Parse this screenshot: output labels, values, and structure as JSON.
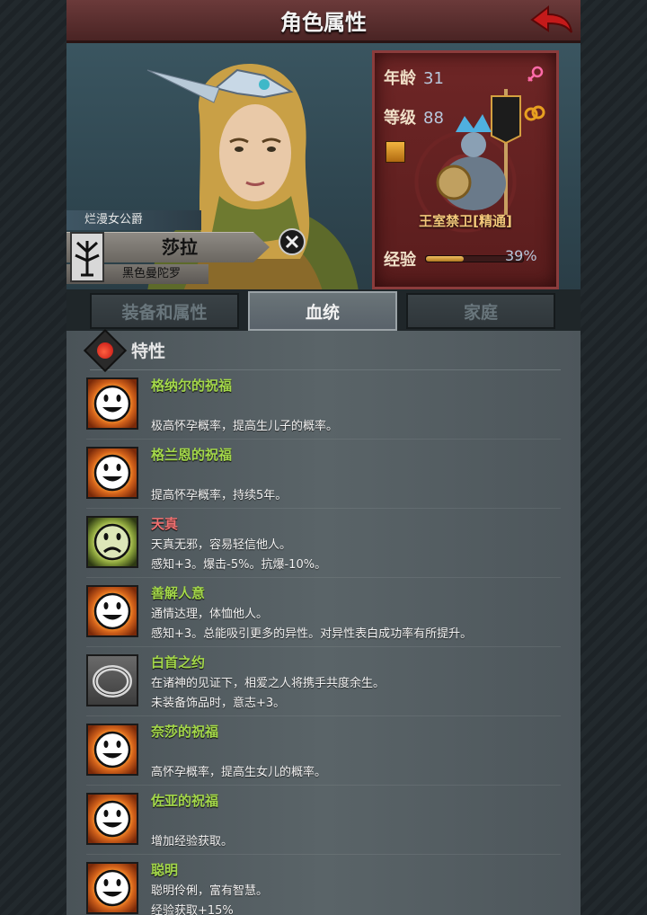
{
  "header": {
    "title": "角色属性"
  },
  "character": {
    "title_tag": "烂漫女公爵",
    "name": "莎拉",
    "house": "黑色曼陀罗",
    "age_label": "年龄",
    "age": "31",
    "level_label": "等级",
    "level": "88",
    "unit": "王室禁卫[精通]",
    "exp_label": "经验",
    "exp_percent": "39%",
    "exp_fraction": 0.39
  },
  "tabs": [
    {
      "label": "装备和属性"
    },
    {
      "label": "血统"
    },
    {
      "label": "家庭"
    }
  ],
  "active_tab": 1,
  "section": {
    "title": "特性"
  },
  "traits": [
    {
      "name": "格纳尔的祝福",
      "icon": "smile-icon",
      "kind": "good",
      "lines": [
        "极高怀孕概率，提高生儿子的概率。"
      ]
    },
    {
      "name": "格兰恩的祝福",
      "icon": "smile-icon",
      "kind": "good",
      "lines": [
        "提高怀孕概率，持续5年。"
      ]
    },
    {
      "name": "天真",
      "icon": "frown-icon",
      "kind": "bad",
      "lines": [
        "天真无邪，容易轻信他人。",
        "感知+3。爆击-5%。抗爆-10%。"
      ]
    },
    {
      "name": "善解人意",
      "icon": "smile-icon",
      "kind": "good",
      "lines": [
        "通情达理，体恤他人。",
        "感知+3。总能吸引更多的异性。对异性表白成功率有所提升。"
      ]
    },
    {
      "name": "白首之约",
      "icon": "ring-icon",
      "kind": "ring",
      "lines": [
        "在诸神的见证下，相爱之人将携手共度余生。",
        "未装备饰品时，意志+3。"
      ]
    },
    {
      "name": "奈莎的祝福",
      "icon": "smile-icon",
      "kind": "good",
      "lines": [
        "高怀孕概率，提高生女儿的概率。"
      ]
    },
    {
      "name": "佐亚的祝福",
      "icon": "smile-icon",
      "kind": "good",
      "lines": [
        "增加经验获取。"
      ]
    },
    {
      "name": "聪明",
      "icon": "smile-icon",
      "kind": "good",
      "lines": [
        "聪明伶俐，富有智慧。",
        "经验获取+15%"
      ]
    }
  ]
}
